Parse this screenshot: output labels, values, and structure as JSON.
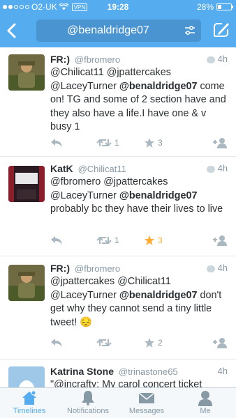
{
  "status_bar": {
    "carrier": "O2-UK",
    "vpn": "VPN",
    "time": "19:28",
    "battery": "28%",
    "battery_level": 0.28
  },
  "nav": {
    "search_query": "@benaldridge07",
    "back_icon": "chevron-left-icon",
    "filter_icon": "sliders-icon",
    "compose_icon": "compose-icon"
  },
  "tweets": [
    {
      "name": "FR:)",
      "handle": "@fbromero",
      "time": "4h",
      "text_1": "@Chilicat11 @jpattercakes @LaceyTurner ",
      "mention": "@benaldridge07",
      "text_2": " come on! TG and some of 2 section have and they also have a life.I have one & v busy 1",
      "retweets": "1",
      "favorites": "3",
      "favorited": false
    },
    {
      "name": "KatK",
      "handle": "@Chilicat11",
      "time": "4h",
      "text_1": "@fbromero @jpattercakes @LaceyTurner ",
      "mention": "@benaldridge07",
      "text_2": " probably bc they have their lives to live",
      "retweets": "1",
      "favorites": "3",
      "favorited": true
    },
    {
      "name": "FR:)",
      "handle": "@fbromero",
      "time": "4h",
      "text_1": "@jpattercakes @Chilicat11 @LaceyTurner ",
      "mention": "@benaldridge07",
      "text_2": "  don't get why they cannot send a tiny little tweet!  😔",
      "retweets": "",
      "favorites": "2",
      "favorited": false
    },
    {
      "name": "Katrina Stone",
      "handle": "@trinastone65",
      "time": "4h",
      "text_1": "\"@incrafty: My carol concert ticket",
      "mention": "",
      "text_2": ""
    }
  ],
  "tabbar": [
    {
      "label": "Timelines",
      "icon": "home-icon",
      "active": true
    },
    {
      "label": "Notifications",
      "icon": "bell-icon",
      "active": false
    },
    {
      "label": "Messages",
      "icon": "envelope-icon",
      "active": false
    },
    {
      "label": "Me",
      "icon": "person-icon",
      "active": false
    }
  ],
  "colors": {
    "brand": "#55acee",
    "favorite": "#ffac33",
    "muted": "#8899a6"
  }
}
